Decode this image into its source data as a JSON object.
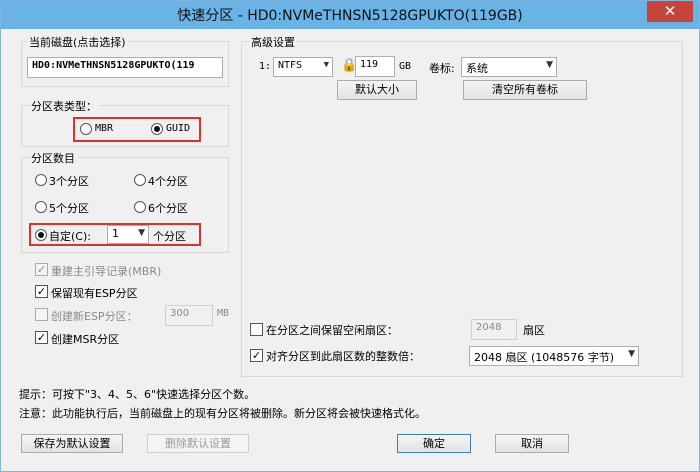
{
  "window": {
    "title": "快速分区 - HD0:NVMeTHNSN5128GPUKTO(119GB)",
    "close": "✕"
  },
  "disk": {
    "label": "当前磁盘(点击选择)",
    "value": "HD0:NVMeTHNSN5128GPUKTO(119"
  },
  "partition_table": {
    "label": "分区表类型：",
    "mbr": "MBR",
    "guid": "GUID",
    "selected": "GUID"
  },
  "partition_count": {
    "label": "分区数目",
    "three": "3个分区",
    "four": "4个分区",
    "five": "5个分区",
    "six": "6个分区",
    "custom": "自定(C):",
    "custom_value": "1",
    "custom_suffix": "个分区",
    "selected": "custom"
  },
  "options": {
    "rebuild_mbr": "重建主引导记录(MBR)",
    "keep_esp": "保留现有ESP分区",
    "create_esp": "创建新ESP分区：",
    "esp_size": "300",
    "esp_unit": "MB",
    "create_msr": "创建MSR分区"
  },
  "advanced": {
    "label": "高级设置",
    "row_index": "1:",
    "fs": "NTFS",
    "size": "119",
    "size_unit": "GB",
    "volume_label_text": "卷标:",
    "volume_label": "系统",
    "default_size_btn": "默认大小",
    "clear_labels_btn": "清空所有卷标",
    "reserve_gap": "在分区之间保留空闲扇区：",
    "reserve_value": "2048",
    "reserve_unit": "扇区",
    "align": "对齐分区到此扇区数的整数倍：",
    "align_value": "2048 扇区 (1048576 字节)"
  },
  "hints": {
    "tip": "提示：可按下\"3、4、5、6\"快速选择分区个数。",
    "note": "注意：此功能执行后，当前磁盘上的现有分区将被删除。新分区将会被快速格式化。"
  },
  "buttons": {
    "save_default": "保存为默认设置",
    "delete_default": "删除默认设置",
    "ok": "确定",
    "cancel": "取消"
  }
}
